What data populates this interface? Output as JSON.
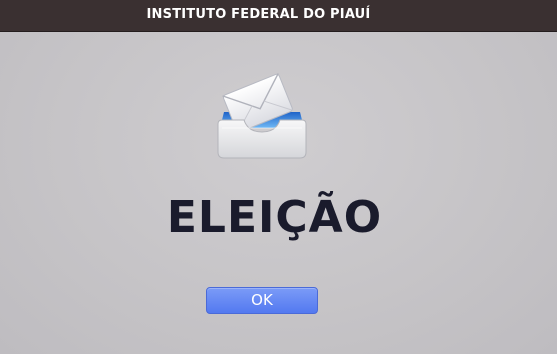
{
  "titlebar": {
    "title": "INSTITUTO FEDERAL DO PIAUÍ"
  },
  "main": {
    "icon": "inbox-mail-icon",
    "heading": "ELEIÇÃO"
  },
  "dialog": {
    "ok_label": "OK"
  },
  "colors": {
    "titlebar_bg": "#3a3031",
    "window_bg": "#c8c6c9",
    "heading": "#1a1b2c",
    "button_accent": "#5b80f2"
  }
}
